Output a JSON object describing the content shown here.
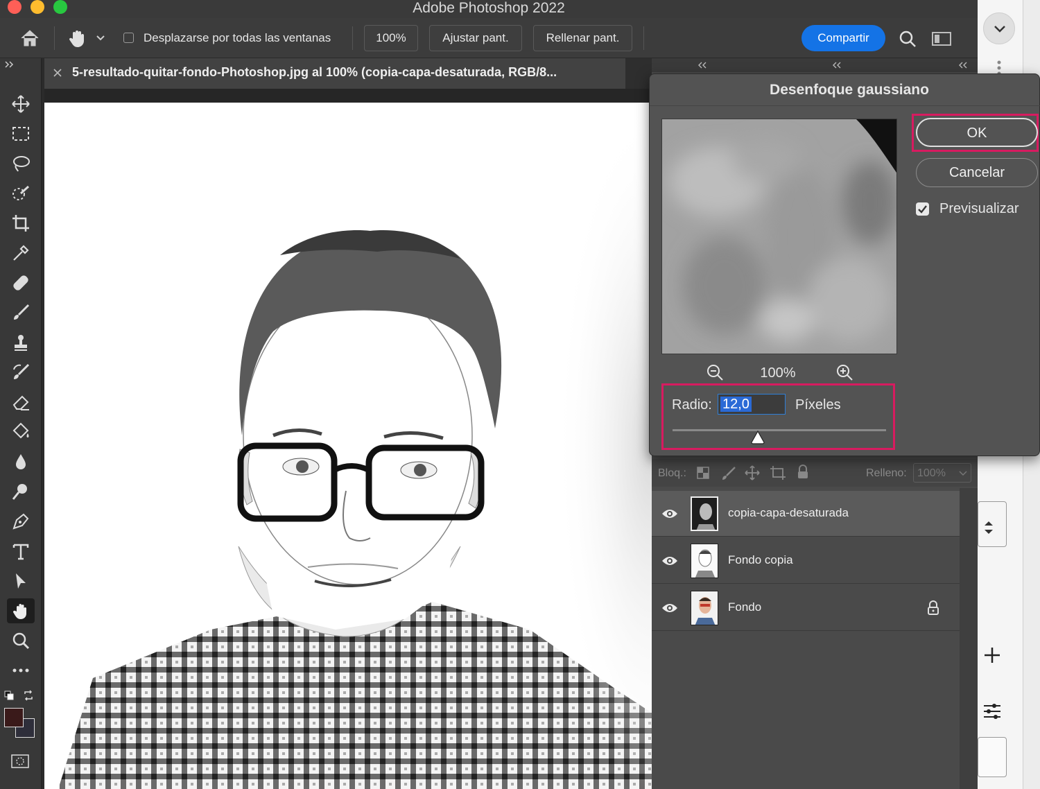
{
  "app": {
    "title": "Adobe Photoshop 2022"
  },
  "options_bar": {
    "scroll_all_label": "Desplazarse por todas las ventanas",
    "zoom_100_label": "100%",
    "fit_screen_label": "Ajustar pant.",
    "fill_screen_label": "Rellenar pant.",
    "share_label": "Compartir"
  },
  "document": {
    "tab_title": "5-resultado-quitar-fondo-Photoshop.jpg al 100% (copia-capa-desaturada, RGB/8..."
  },
  "dialog": {
    "title": "Desenfoque gaussiano",
    "ok_label": "OK",
    "cancel_label": "Cancelar",
    "preview_label": "Previsualizar",
    "preview_checked": true,
    "zoom_level": "100%",
    "radius_label": "Radio:",
    "radius_value": "12,0",
    "radius_unit": "Píxeles",
    "radius_slider_fraction": 0.4
  },
  "layers_panel": {
    "lock_label": "Bloq.:",
    "fill_label": "Relleno:",
    "fill_value": "100%",
    "layers": [
      {
        "name": "copia-capa-desaturada",
        "visible": true,
        "selected": true,
        "locked": false
      },
      {
        "name": "Fondo copia",
        "visible": true,
        "selected": false,
        "locked": false
      },
      {
        "name": "Fondo",
        "visible": true,
        "selected": false,
        "locked": true
      }
    ]
  },
  "colors": {
    "accent_blue": "#1473e6",
    "highlight_red": "#d81b60",
    "foreground": "#3a1a1a",
    "background": "#2e2e3a"
  }
}
